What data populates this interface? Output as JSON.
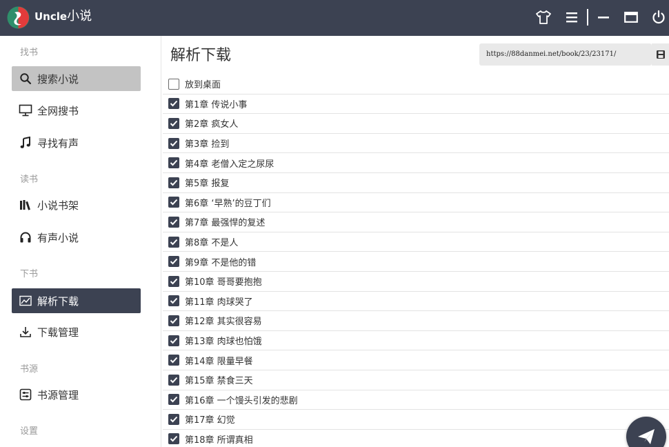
{
  "app": {
    "title_en": "Uncle",
    "title_cn": "小说"
  },
  "window_controls": {
    "skin_icon": "tshirt-icon",
    "menu_icon": "hamburger-icon",
    "minimize_icon": "minimize-icon",
    "maximize_icon": "maximize-icon",
    "power_icon": "power-icon"
  },
  "sidebar": {
    "sections": [
      {
        "label": "找书"
      },
      {
        "label": "读书"
      },
      {
        "label": "下书"
      },
      {
        "label": "书源"
      },
      {
        "label": "设置"
      }
    ],
    "items": [
      {
        "label": "搜索小说",
        "icon": "search-icon",
        "state": "hover"
      },
      {
        "label": "全网搜书",
        "icon": "monitor-icon"
      },
      {
        "label": "寻找有声",
        "icon": "music-note-icon"
      },
      {
        "label": "小说书架",
        "icon": "bookshelf-icon"
      },
      {
        "label": "有声小说",
        "icon": "headphones-icon"
      },
      {
        "label": "解析下载",
        "icon": "chart-icon",
        "state": "active"
      },
      {
        "label": "下载管理",
        "icon": "download-icon"
      },
      {
        "label": "书源管理",
        "icon": "sliders-icon"
      }
    ]
  },
  "main": {
    "title": "解析下载",
    "url": "https://88danmei.net/book/23/23171/",
    "url_action_icon": "save-icon",
    "send_icon": "paper-plane-icon"
  },
  "chapters": [
    {
      "label": "放到桌面",
      "checked": false
    },
    {
      "label": "第1章 传说小事",
      "checked": true
    },
    {
      "label": "第2章 疯女人",
      "checked": true
    },
    {
      "label": "第3章 捡到",
      "checked": true
    },
    {
      "label": "第4章 老僧入定之尿尿",
      "checked": true
    },
    {
      "label": "第5章 报复",
      "checked": true
    },
    {
      "label": "第6章 ‘早熟’的豆丁们",
      "checked": true
    },
    {
      "label": "第7章 最强悍的复述",
      "checked": true
    },
    {
      "label": "第8章 不是人",
      "checked": true
    },
    {
      "label": "第9章 不是他的错",
      "checked": true
    },
    {
      "label": "第10章 哥哥要抱抱",
      "checked": true
    },
    {
      "label": "第11章 肉球哭了",
      "checked": true
    },
    {
      "label": "第12章 其实很容易",
      "checked": true
    },
    {
      "label": "第13章 肉球也怕饿",
      "checked": true
    },
    {
      "label": "第14章 限量早餐",
      "checked": true
    },
    {
      "label": "第15章 禁食三天",
      "checked": true
    },
    {
      "label": "第16章 一个馒头引发的悲剧",
      "checked": true
    },
    {
      "label": "第17章 幻觉",
      "checked": true
    },
    {
      "label": "第18章 所谓真相",
      "checked": true
    }
  ],
  "colors": {
    "titlebar": "#3c4252",
    "accent": "#3c4252",
    "hover": "#c3c3c3"
  }
}
